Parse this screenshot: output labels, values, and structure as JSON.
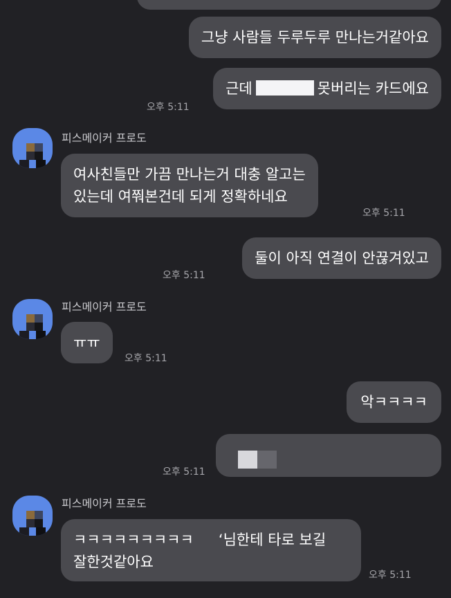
{
  "messages": {
    "m1": {
      "text": "그냥 사람들 두루두루 만나는거같아요"
    },
    "m2": {
      "prefix": "근데",
      "suffix": "못버리는 카드에요",
      "time": "오후 5:11"
    },
    "m3": {
      "sender": "피스메이커 프로도",
      "line1": "여사친들만 가끔 만나는거 대충 알고는",
      "line2": "있는데 여쭤본건데 되게 정확하네요",
      "time": "오후 5:11"
    },
    "m4": {
      "text": "둘이 아직 연결이 안끊겨있고",
      "time": "오후 5:11"
    },
    "m5": {
      "sender": "피스메이커 프로도",
      "text": "ㅠㅠ",
      "time": "오후 5:11"
    },
    "m6": {
      "text": "악ㅋㅋㅋㅋ"
    },
    "m7": {
      "time": "오후 5:11"
    },
    "m8": {
      "sender": "피스메이커 프로도",
      "line1_a": "ㅋㅋㅋㅋㅋㅋㅋㅋㅋ",
      "line1_b": "‘님한테 타로 보길",
      "line2": "잘한것같아요",
      "time": "오후 5:11"
    }
  },
  "colors": {
    "background": "#212125",
    "bubble": "#4a4a4f",
    "avatar": "#5b88e6",
    "timestamp": "#a6a6ab",
    "sender": "#c9c9cd"
  }
}
